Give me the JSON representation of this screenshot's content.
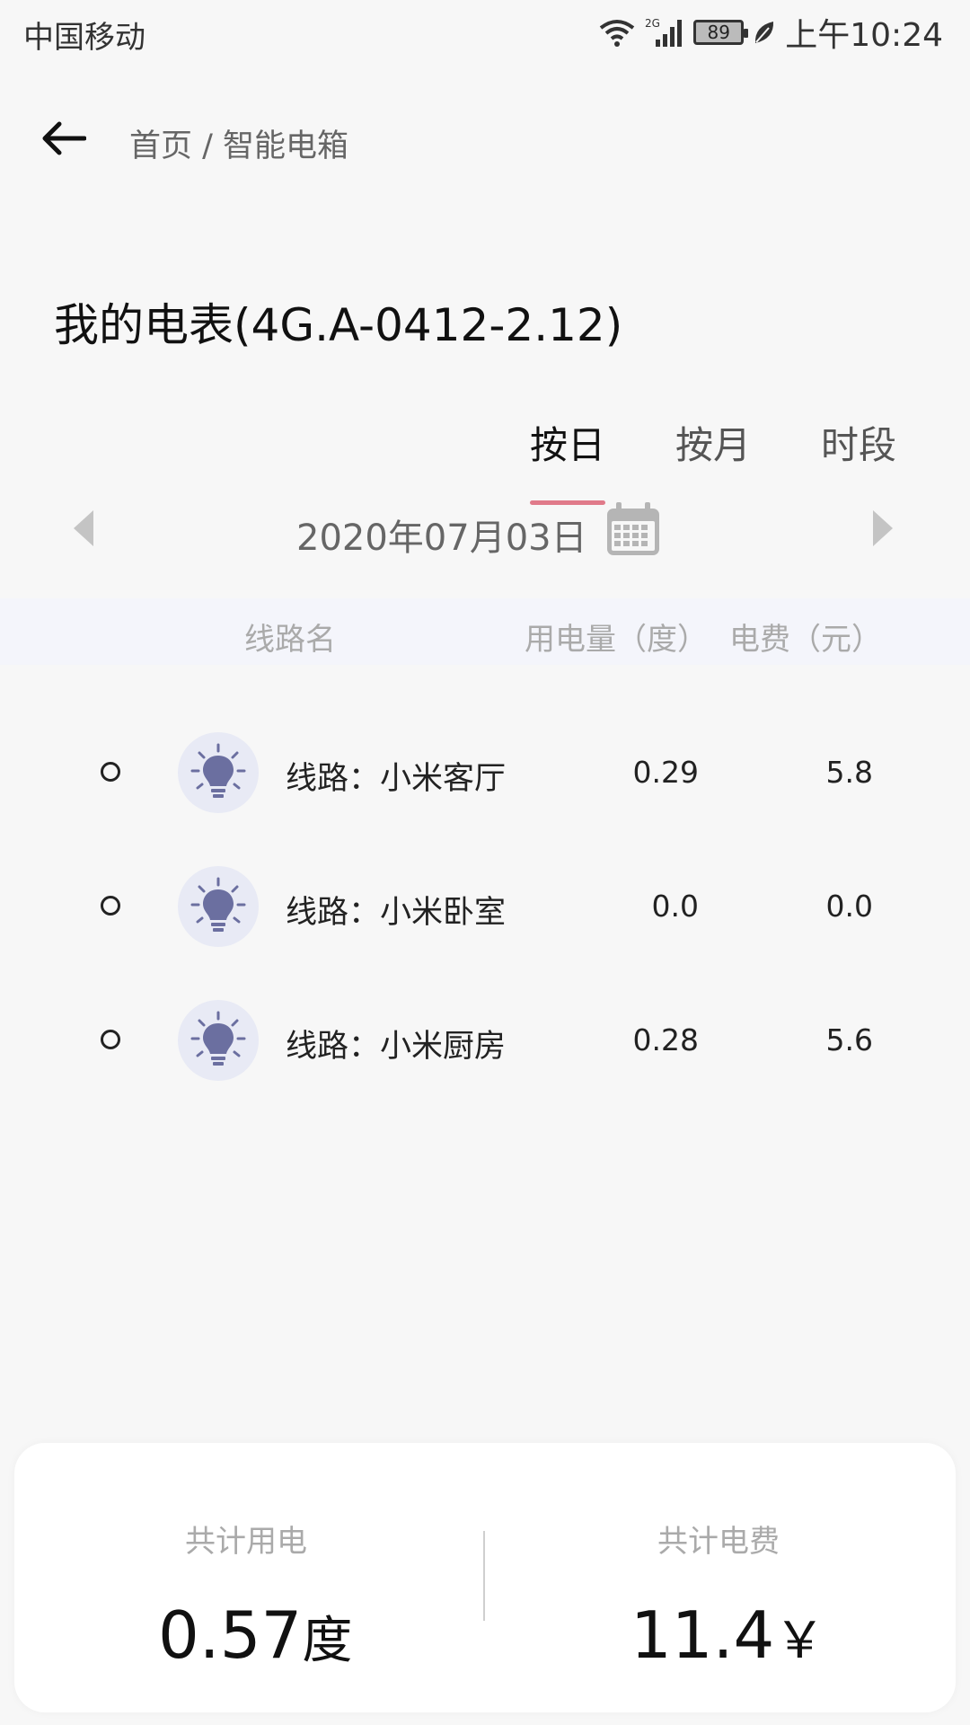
{
  "status_bar": {
    "carrier": "中国移动",
    "network": "2G",
    "battery": "89",
    "time": "上午10:24"
  },
  "header": {
    "breadcrumb": "首页 / 智能电箱"
  },
  "title": "我的电表(4G.A-0412-2.12)",
  "tabs": [
    {
      "label": "按日",
      "active": true
    },
    {
      "label": "按月",
      "active": false
    },
    {
      "label": "时段",
      "active": false
    }
  ],
  "date": "2020年07月03日",
  "table": {
    "headers": {
      "name": "线路名",
      "usage": "用电量（度）",
      "fee": "电费（元）"
    },
    "rows": [
      {
        "name": "线路：小米客厅",
        "usage": "0.29",
        "fee": "5.8"
      },
      {
        "name": "线路：小米卧室",
        "usage": "0.0",
        "fee": "0.0"
      },
      {
        "name": "线路：小米厨房",
        "usage": "0.28",
        "fee": "5.6"
      }
    ]
  },
  "summary": {
    "total_usage_label": "共计用电",
    "total_usage_value": "0.57",
    "total_usage_unit": "度",
    "total_fee_label": "共计电费",
    "total_fee_value": "11.4",
    "total_fee_unit": "￥"
  },
  "colors": {
    "tab_indicator": "#e07a8a",
    "icon_bulb": "#6b6fa0",
    "icon_bg": "#e8eaf5"
  }
}
